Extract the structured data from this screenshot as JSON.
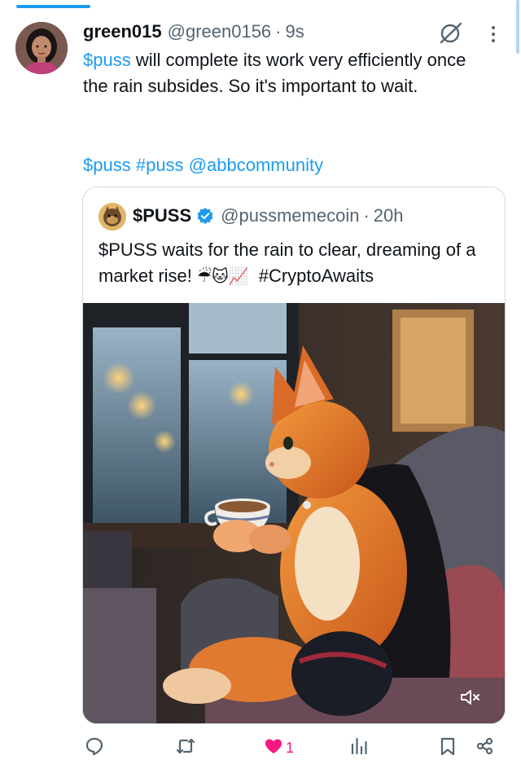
{
  "post": {
    "author": {
      "display_name": "green015",
      "handle": "@green0156",
      "separator": "·",
      "time": "9s"
    },
    "text": {
      "cashtag": "$puss",
      "body": " will complete its work very efficiently once the rain subsides. So it's important to wait."
    },
    "tags": {
      "cashtag": "$puss",
      "hashtag": "#puss",
      "mention": "@abbcommunity"
    },
    "icons": {
      "grok": "grok-icon",
      "more": "more-vertical-icon"
    }
  },
  "quoted": {
    "author": {
      "display_name": "$PUSS",
      "handle": "@pussmemecoin",
      "separator": "·",
      "time": "20h",
      "verified": true
    },
    "text": {
      "line1": "$PUSS waits for the rain to clear, dreaming of a market rise! ",
      "emojis": "☔🐱📈",
      "hashtag": "#CryptoAwaits"
    },
    "media": {
      "kind": "video",
      "muted": true
    }
  },
  "actions": {
    "reply": {
      "icon": "reply-icon"
    },
    "repost": {
      "icon": "repost-icon"
    },
    "like": {
      "icon": "heart-icon",
      "count": "1",
      "liked": true
    },
    "views": {
      "icon": "views-icon"
    },
    "bookmark": {
      "icon": "bookmark-icon"
    },
    "share": {
      "icon": "share-icon"
    }
  },
  "colors": {
    "accent": "#1d9bf0",
    "like": "#f91880",
    "text": "#0f1419",
    "secondary": "#536471"
  }
}
